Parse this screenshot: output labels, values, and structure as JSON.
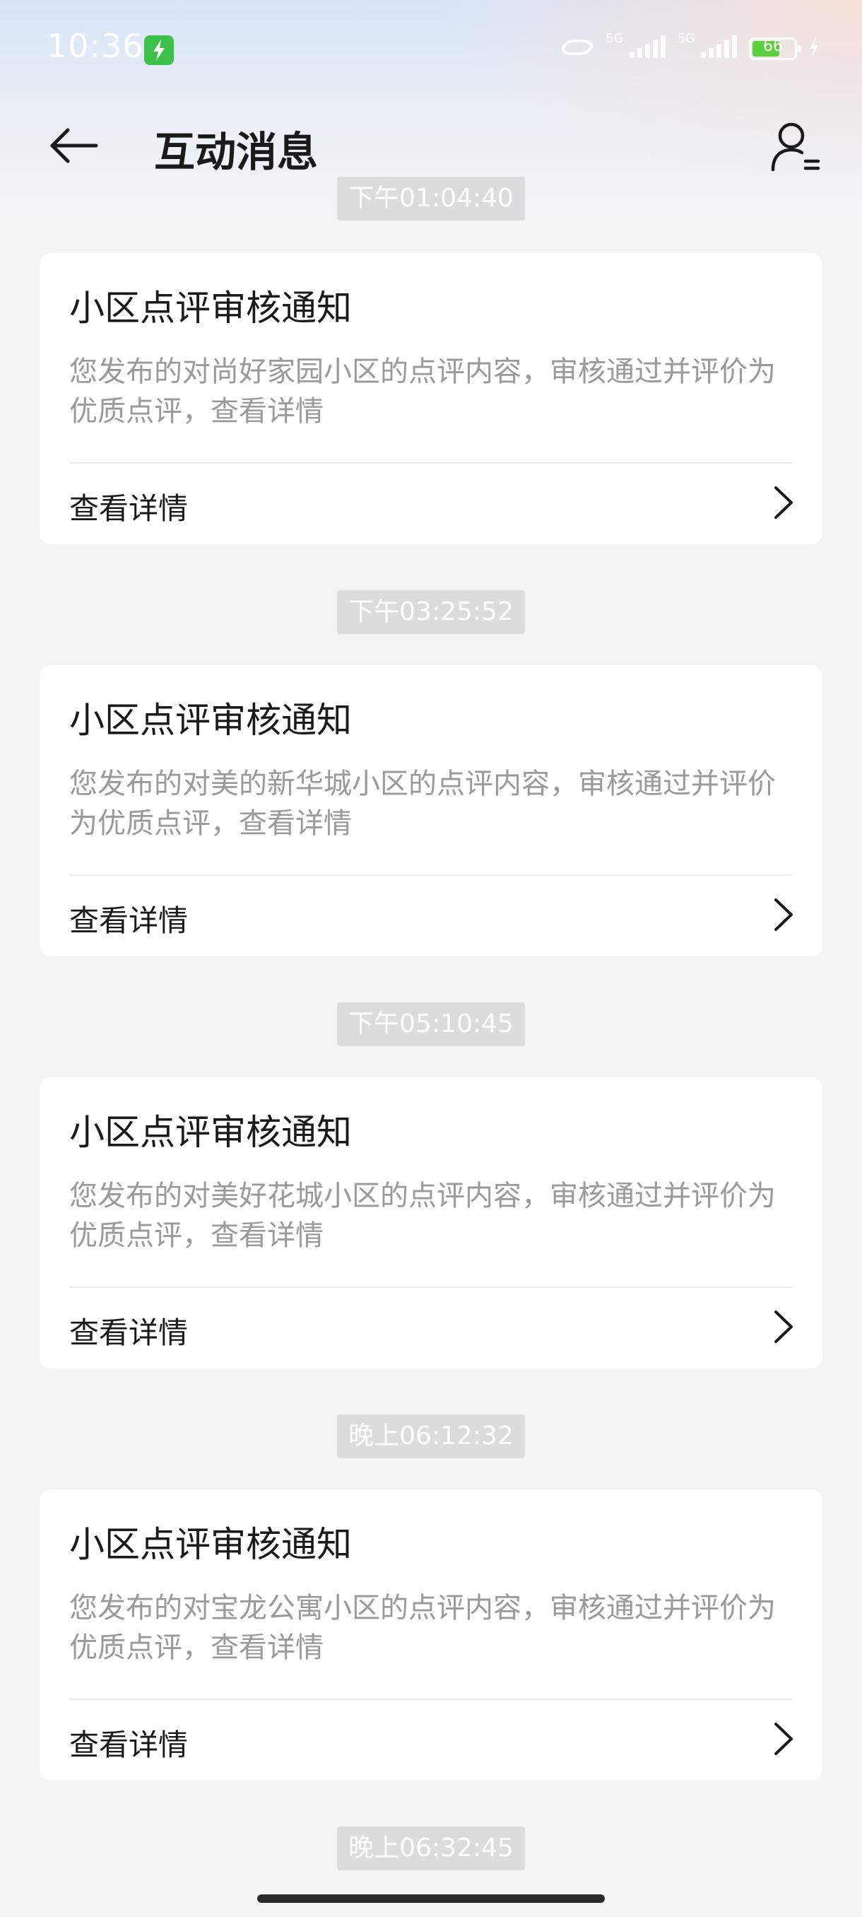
{
  "status_bar": {
    "time": "10:36",
    "network_1": "5G",
    "network_2": "5G",
    "battery_level": "66",
    "battery_fill_fraction": 0.66,
    "colors": {
      "charge_badge": "#3cc24a",
      "battery_fill": "#5ccf3e"
    }
  },
  "header": {
    "title": "互动消息",
    "back_icon": "arrow-left-icon",
    "user_icon": "user-settings-icon"
  },
  "messages": [
    {
      "time": "下午01:04:40",
      "title": "小区点评审核通知",
      "description": "您发布的对尚好家园小区的点评内容，审核通过并评价为优质点评，查看详情",
      "action": "查看详情"
    },
    {
      "time": "下午03:25:52",
      "title": "小区点评审核通知",
      "description": "您发布的对美的新华城小区的点评内容，审核通过并评价为优质点评，查看详情",
      "action": "查看详情"
    },
    {
      "time": "下午05:10:45",
      "title": "小区点评审核通知",
      "description": "您发布的对美好花城小区的点评内容，审核通过并评价为优质点评，查看详情",
      "action": "查看详情"
    },
    {
      "time": "晚上06:12:32",
      "title": "小区点评审核通知",
      "description": "您发布的对宝龙公寓小区的点评内容，审核通过并评价为优质点评，查看详情",
      "action": "查看详情"
    },
    {
      "time": "晚上06:32:45"
    }
  ]
}
